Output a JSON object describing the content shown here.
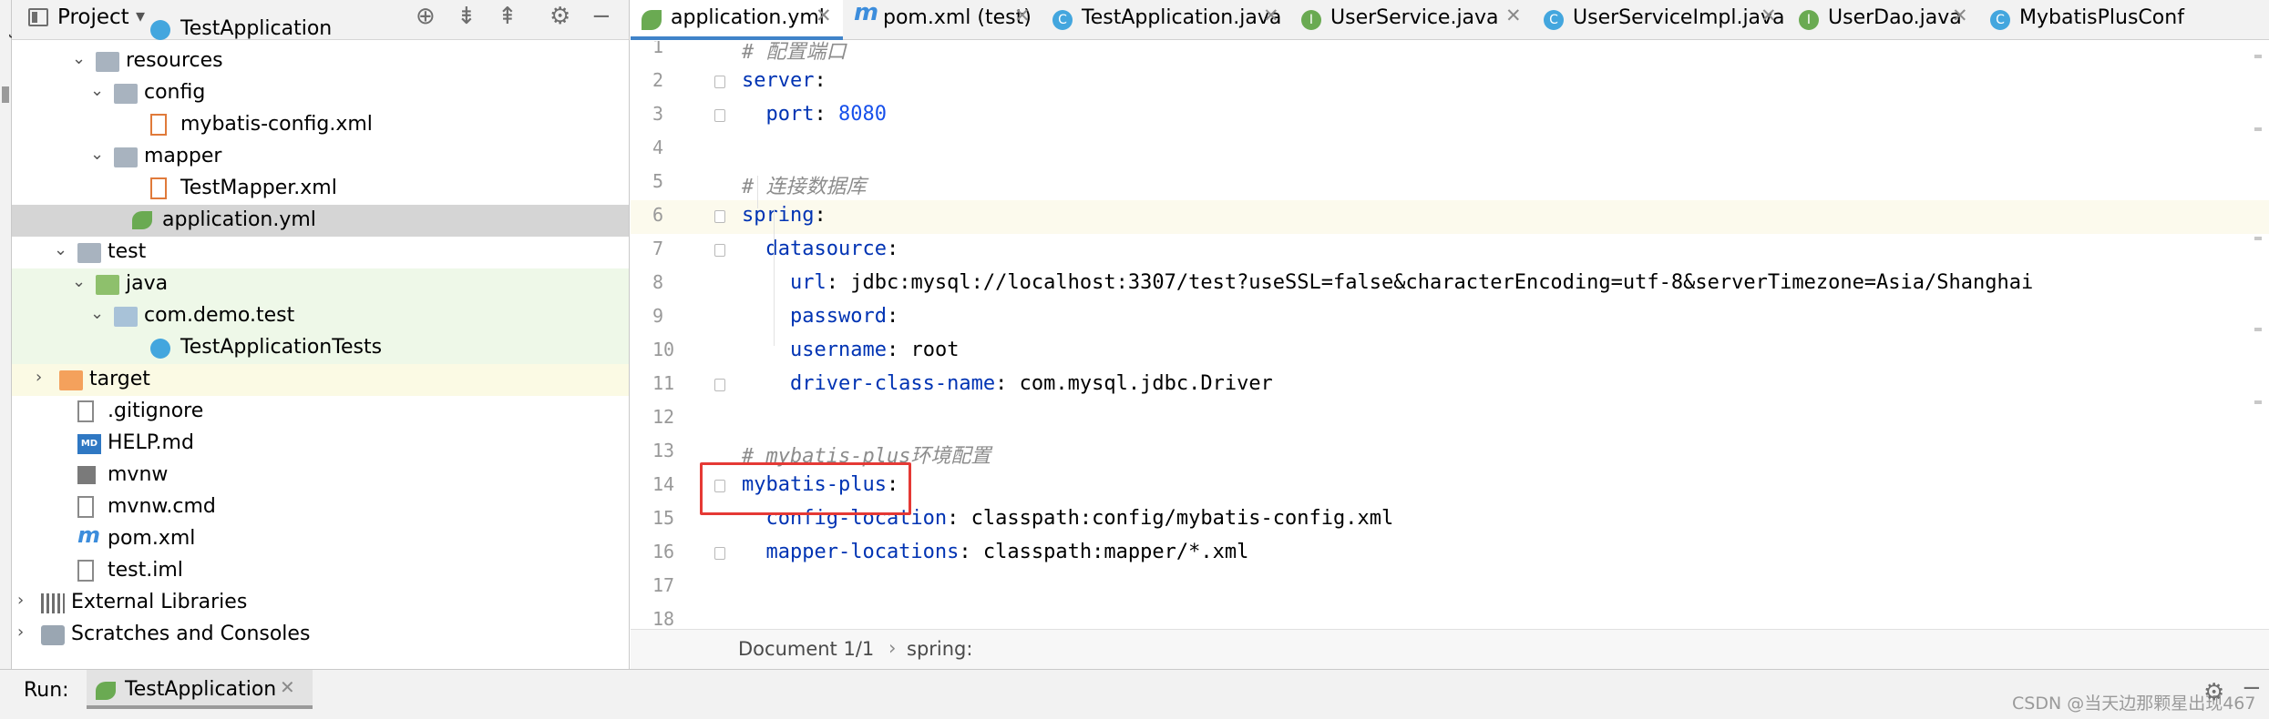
{
  "sidebar_strip": {
    "label": "Project"
  },
  "project_panel": {
    "title": "Project",
    "tree": [
      {
        "label": "TestApplication",
        "kind": "class",
        "depth": 7
      },
      {
        "label": "resources",
        "kind": "folder",
        "depth": 4,
        "expanded": true
      },
      {
        "label": "config",
        "kind": "folder",
        "depth": 5,
        "expanded": true
      },
      {
        "label": "mybatis-config.xml",
        "kind": "xml",
        "depth": 7
      },
      {
        "label": "mapper",
        "kind": "folder",
        "depth": 5,
        "expanded": true
      },
      {
        "label": "TestMapper.xml",
        "kind": "xml",
        "depth": 7
      },
      {
        "label": "application.yml",
        "kind": "yml",
        "depth": 6,
        "selected": true
      },
      {
        "label": "test",
        "kind": "folder",
        "depth": 3,
        "expanded": true
      },
      {
        "label": "java",
        "kind": "folder-green",
        "depth": 4,
        "expanded": true
      },
      {
        "label": "com.demo.test",
        "kind": "package",
        "depth": 5,
        "expanded": true
      },
      {
        "label": "TestApplicationTests",
        "kind": "class",
        "depth": 7
      },
      {
        "label": "target",
        "kind": "folder-orange",
        "depth": 2,
        "expanded": false
      },
      {
        "label": ".gitignore",
        "kind": "file",
        "depth": 3
      },
      {
        "label": "HELP.md",
        "kind": "md",
        "depth": 3
      },
      {
        "label": "mvnw",
        "kind": "terminal",
        "depth": 3
      },
      {
        "label": "mvnw.cmd",
        "kind": "file",
        "depth": 3
      },
      {
        "label": "pom.xml",
        "kind": "maven",
        "depth": 3
      },
      {
        "label": "test.iml",
        "kind": "file",
        "depth": 3
      },
      {
        "label": "External Libraries",
        "kind": "library",
        "depth": 1,
        "expanded": false
      },
      {
        "label": "Scratches and Consoles",
        "kind": "scratch",
        "depth": 1,
        "expanded": false
      }
    ]
  },
  "tabs": [
    {
      "label": "application.yml",
      "icon": "yml-icon",
      "active": true
    },
    {
      "label": "pom.xml (test)",
      "icon": "maven-icon"
    },
    {
      "label": "TestApplication.java",
      "icon": "class-icon"
    },
    {
      "label": "UserService.java",
      "icon": "interface-icon"
    },
    {
      "label": "UserServiceImpl.java",
      "icon": "class-icon"
    },
    {
      "label": "UserDao.java",
      "icon": "interface-icon"
    },
    {
      "label": "MybatisPlusConf",
      "icon": "class-icon"
    }
  ],
  "editor": {
    "current_line": 6,
    "lines": [
      {
        "n": "1",
        "tokens": [
          {
            "t": "# 配置端口",
            "c": "cmt"
          }
        ]
      },
      {
        "n": "2",
        "tokens": [
          {
            "t": "server",
            "c": "key"
          },
          {
            "t": ":",
            "c": "pun"
          }
        ]
      },
      {
        "n": "3",
        "tokens": [
          {
            "t": "  port",
            "c": "key"
          },
          {
            "t": ": ",
            "c": "pun"
          },
          {
            "t": "8080",
            "c": "num"
          }
        ]
      },
      {
        "n": "4",
        "tokens": []
      },
      {
        "n": "5",
        "tokens": [
          {
            "t": "# 连接数据库",
            "c": "cmt"
          }
        ]
      },
      {
        "n": "6",
        "tokens": [
          {
            "t": "spring",
            "c": "key"
          },
          {
            "t": ":",
            "c": "pun"
          }
        ]
      },
      {
        "n": "7",
        "tokens": [
          {
            "t": "  datasource",
            "c": "key"
          },
          {
            "t": ":",
            "c": "pun"
          }
        ]
      },
      {
        "n": "8",
        "tokens": [
          {
            "t": "    url",
            "c": "key"
          },
          {
            "t": ": ",
            "c": "pun"
          },
          {
            "t": "jdbc:mysql://localhost:3307/test?useSSL=false&characterEncoding=utf-8&serverTimezone=Asia/Shanghai",
            "c": "val"
          }
        ]
      },
      {
        "n": "9",
        "tokens": [
          {
            "t": "    password",
            "c": "key"
          },
          {
            "t": ":",
            "c": "pun"
          }
        ]
      },
      {
        "n": "10",
        "tokens": [
          {
            "t": "    username",
            "c": "key"
          },
          {
            "t": ": ",
            "c": "pun"
          },
          {
            "t": "root",
            "c": "val"
          }
        ]
      },
      {
        "n": "11",
        "tokens": [
          {
            "t": "    driver-class-name",
            "c": "key"
          },
          {
            "t": ": ",
            "c": "pun"
          },
          {
            "t": "com.mysql.jdbc.Driver",
            "c": "val"
          }
        ]
      },
      {
        "n": "12",
        "tokens": []
      },
      {
        "n": "13",
        "tokens": [
          {
            "t": "# mybatis-plus环境配置",
            "c": "cmt"
          }
        ]
      },
      {
        "n": "14",
        "tokens": [
          {
            "t": "mybatis-plus",
            "c": "key"
          },
          {
            "t": ":",
            "c": "pun"
          }
        ]
      },
      {
        "n": "15",
        "tokens": [
          {
            "t": "  config-location",
            "c": "key"
          },
          {
            "t": ": ",
            "c": "pun"
          },
          {
            "t": "classpath:config/mybatis-config.xml",
            "c": "val"
          }
        ]
      },
      {
        "n": "16",
        "tokens": [
          {
            "t": "  mapper-locations",
            "c": "key"
          },
          {
            "t": ": ",
            "c": "pun"
          },
          {
            "t": "classpath:mapper/*.xml",
            "c": "val"
          }
        ]
      },
      {
        "n": "17",
        "tokens": []
      },
      {
        "n": "18",
        "tokens": []
      }
    ]
  },
  "breadcrumb": {
    "doc": "Document 1/1",
    "sep": "›",
    "path": "spring:"
  },
  "run_bar": {
    "label": "Run:",
    "tab_label": "TestApplication",
    "close": "✕"
  },
  "watermark": "CSDN @当天边那颗星出现467",
  "colors": {
    "accent": "#4083c9",
    "highlight": "#e53935",
    "key": "#0033b3",
    "number": "#1750eb",
    "comment": "#8c8c8c"
  }
}
